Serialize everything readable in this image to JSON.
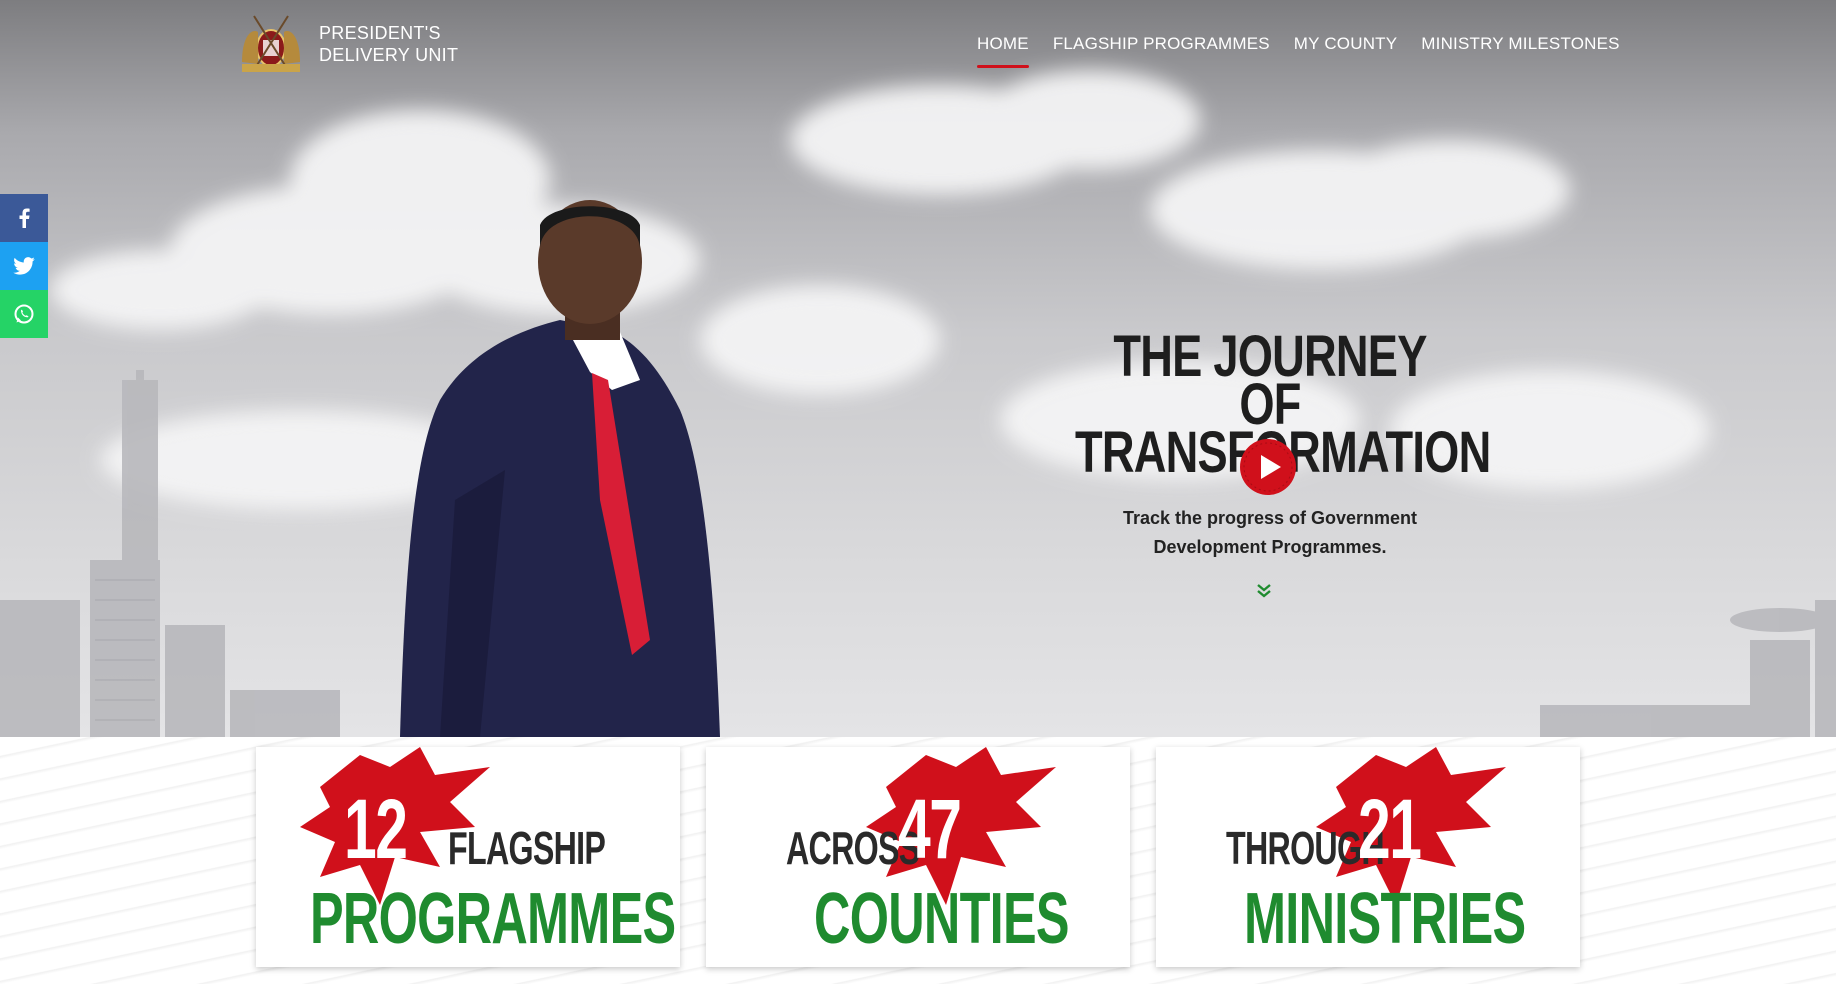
{
  "header": {
    "brand_line1": "PRESIDENT'S",
    "brand_line2": "DELIVERY UNIT",
    "nav": [
      {
        "label": "HOME",
        "active": true
      },
      {
        "label": "FLAGSHIP PROGRAMMES",
        "active": false
      },
      {
        "label": "MY COUNTY",
        "active": false
      },
      {
        "label": "MINISTRY MILESTONES",
        "active": false
      }
    ]
  },
  "social": [
    "facebook-icon",
    "twitter-icon",
    "whatsapp-icon"
  ],
  "hero": {
    "headline_line1": "THE JOURNEY",
    "headline_line2": "OF TRANSFORMATION",
    "tagline_line1": "Track the progress of Government",
    "tagline_line2": "Development Programmes."
  },
  "stats": [
    {
      "number": "12",
      "small": "FLAGSHIP",
      "big": "PROGRAMMES"
    },
    {
      "number": "47",
      "small": "ACROSS",
      "big": "COUNTIES"
    },
    {
      "number": "21",
      "small": "THROUGH",
      "big": "MINISTRIES"
    }
  ],
  "colors": {
    "accent_red": "#d0101b",
    "green": "#1f8b2f",
    "facebook": "#3b5998",
    "twitter": "#1da1f2",
    "whatsapp": "#25d366"
  }
}
